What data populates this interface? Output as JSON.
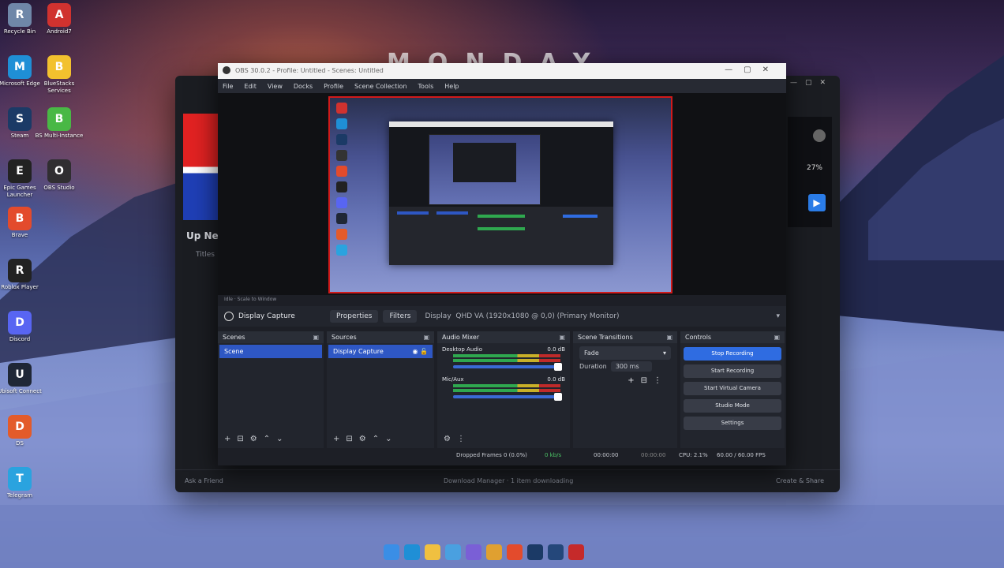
{
  "wallpaper_text": "MONDAY",
  "desktop_icons": [
    {
      "label": "Recycle Bin",
      "icon": "recycle-bin-icon",
      "color": "#6f87a8"
    },
    {
      "label": "Android7",
      "icon": "android-app-icon",
      "color": "#d0322f"
    },
    {
      "label": "Microsoft Edge",
      "icon": "edge-icon",
      "color": "#1f8fd6"
    },
    {
      "label": "BlueStacks Services",
      "icon": "bluestacks-icon",
      "color": "#f2c12e"
    },
    {
      "label": "Steam",
      "icon": "steam-icon",
      "color": "#1b3a66"
    },
    {
      "label": "BS Multi-Instance",
      "icon": "bluestacks-multi-icon",
      "color": "#49b845"
    },
    {
      "label": "Epic Games Launcher",
      "icon": "epic-games-icon",
      "color": "#222"
    },
    {
      "label": "OBS Studio",
      "icon": "obs-icon",
      "color": "#302e31"
    },
    {
      "label": "Brave",
      "icon": "brave-icon",
      "color": "#e34b2c"
    },
    {
      "label": "Roblox Player",
      "icon": "roblox-icon",
      "color": "#222"
    },
    {
      "label": "Discord",
      "icon": "discord-icon",
      "color": "#5865f2"
    },
    {
      "label": "Ubisoft Connect",
      "icon": "ubisoft-icon",
      "color": "#1f2736"
    },
    {
      "label": "DS",
      "icon": "ds-icon",
      "color": "#e35b2a"
    },
    {
      "label": "Telegram",
      "icon": "telegram-icon",
      "color": "#2aa3df"
    }
  ],
  "bg_window": {
    "up_next": "Up Next",
    "up_next_sub": "Titles",
    "percent": "27%",
    "bottom_left": "Ask a Friend",
    "bottom_center": "Download Manager · 1 item downloading",
    "bottom_right": "Create & Share"
  },
  "obs": {
    "title": "OBS 30.0.2 - Profile: Untitled - Scenes: Untitled",
    "menu": [
      "File",
      "Edit",
      "View",
      "Docks",
      "Profile",
      "Scene Collection",
      "Tools",
      "Help"
    ],
    "preview_bar": "Idle · Scale to Window",
    "toolbar": {
      "source_name": "Display Capture",
      "properties": "Properties",
      "filters": "Filters",
      "display_label": "Display",
      "display_value": "QHD VA (1920x1080 @ 0,0) (Primary Monitor)"
    },
    "docks": {
      "scenes": {
        "title": "Scenes",
        "items": [
          "Scene"
        ]
      },
      "sources": {
        "title": "Sources",
        "items": [
          "Display Capture"
        ]
      },
      "mixer": {
        "title": "Audio Mixer",
        "channels": [
          {
            "name": "Desktop Audio",
            "db": "0.0 dB"
          },
          {
            "name": "Mic/Aux",
            "db": "0.0 dB"
          }
        ]
      },
      "transitions": {
        "title": "Scene Transitions",
        "type": "Fade",
        "duration_label": "Duration",
        "duration": "300 ms"
      },
      "controls": {
        "title": "Controls",
        "buttons": [
          "Stop Recording",
          "Start Recording",
          "Start Virtual Camera",
          "Studio Mode",
          "Settings"
        ]
      }
    },
    "status": {
      "dropped": "Dropped Frames 0 (0.0%)",
      "bitrate": "0 kb/s",
      "rec_time": "00:00:00",
      "stream_time": "00:00:00",
      "cpu": "CPU: 2.1%",
      "fps": "60.00 / 60.00 FPS"
    }
  },
  "colors": {
    "accent": "#2e57c4",
    "record_border": "#d11a1a",
    "play_button": "#2b7de9"
  },
  "taskbar_icons": [
    "windows-icon",
    "edge-icon",
    "explorer-icon",
    "store-icon",
    "app-icon",
    "chrome-icon",
    "brave-icon",
    "steam-icon",
    "steam-icon",
    "obs-icon"
  ]
}
